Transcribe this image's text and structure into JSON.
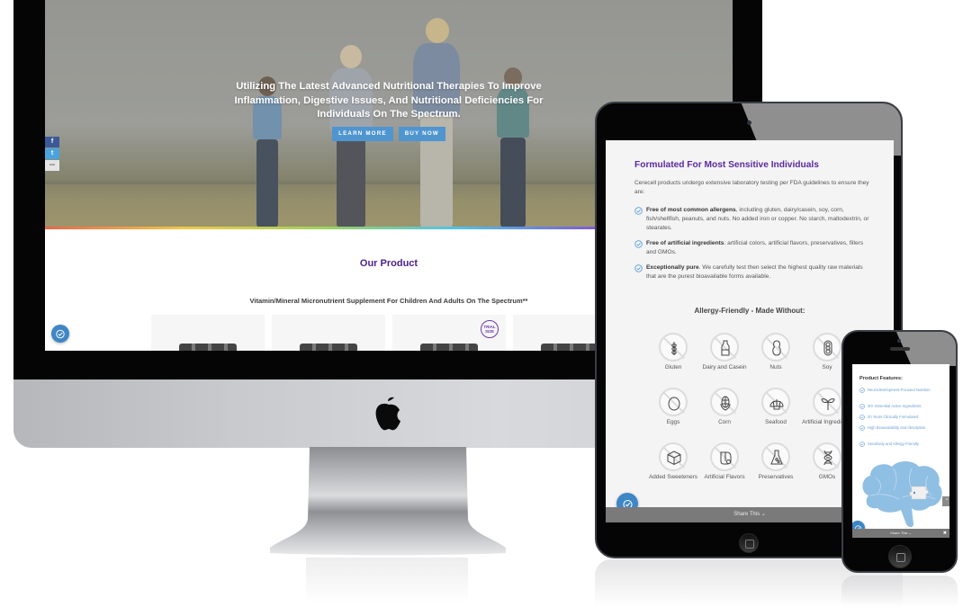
{
  "desktop": {
    "hero": {
      "headline": "Utilizing The Latest Advanced Nutritional Therapies To Improve Inflammation, Digestive Issues, And Nutritional Deficiencies For Individuals On The Spectrum.",
      "buttons": [
        {
          "label": "LEARN MORE"
        },
        {
          "label": "BUY NOW"
        }
      ],
      "accent_color": "#4f95cf"
    },
    "share_rail": [
      {
        "icon": "facebook-icon",
        "glyph": "f"
      },
      {
        "icon": "twitter-icon",
        "glyph": "t"
      },
      {
        "icon": "more-icon",
        "glyph": "•••"
      }
    ],
    "product_section": {
      "title": "Our Product",
      "subtitle": "Vitamin/Mineral Micronutrient Supplement For Children And Adults On The Spectrum**",
      "title_color": "#4b1f8f",
      "cards": [
        {
          "badge": ""
        },
        {
          "badge": ""
        },
        {
          "badge": "TRIAL SIZE"
        },
        {
          "badge": ""
        }
      ]
    }
  },
  "tablet": {
    "section_title": "Formulated For Most Sensitive Individuals",
    "intro": "Cerecell products undergo extensive laboratory testing per FDA guidelines to ensure they are:",
    "checklist": [
      {
        "bold": "Free of most common allergens",
        "text": ", including gluten, dairy/casein, soy, corn, fish/shellfish, peanuts, and nuts. No added iron or copper. No starch, maltodextrin, or stearates."
      },
      {
        "bold": "Free of artificial ingredients",
        "text": ": artificial colors, artificial flavors, preservatives, fillers and GMOs."
      },
      {
        "bold": "Exceptionally pure",
        "text": ". We carefully test then select the highest quality raw materials that are the purest bioavailable forms available."
      }
    ],
    "allergy_title": "Allergy-Friendly - Made Without:",
    "allergens": [
      {
        "label": "Gluten",
        "icon": "wheat-icon"
      },
      {
        "label": "Dairy and Casein",
        "icon": "milk-bottle-icon"
      },
      {
        "label": "Nuts",
        "icon": "peanut-icon"
      },
      {
        "label": "Soy",
        "icon": "soybean-icon"
      },
      {
        "label": "Eggs",
        "icon": "egg-icon"
      },
      {
        "label": "Corn",
        "icon": "corn-icon"
      },
      {
        "label": "Seafood",
        "icon": "shell-icon"
      },
      {
        "label": "Artificial Ingredients",
        "icon": "sprout-icon"
      },
      {
        "label": "Added Sweeteners",
        "icon": "sugar-cube-icon"
      },
      {
        "label": "Artificial Flavors",
        "icon": "flavor-icon"
      },
      {
        "label": "Preservatives",
        "icon": "flask-icon"
      },
      {
        "label": "GMOs",
        "icon": "dna-icon"
      }
    ],
    "share_bar": "Share This"
  },
  "phone": {
    "features_title": "Product Features:",
    "features": [
      "Neurodevelopment-Focused Nutrition",
      "30+ Essential Active Ingredients",
      "20 Years Clinically Formulated",
      "High Bioavailability and Absorption",
      "Sensitivity and Allergy-Friendly"
    ],
    "share_bar": "Share This",
    "close_glyph": "✖",
    "scroll_up_glyph": "^"
  }
}
